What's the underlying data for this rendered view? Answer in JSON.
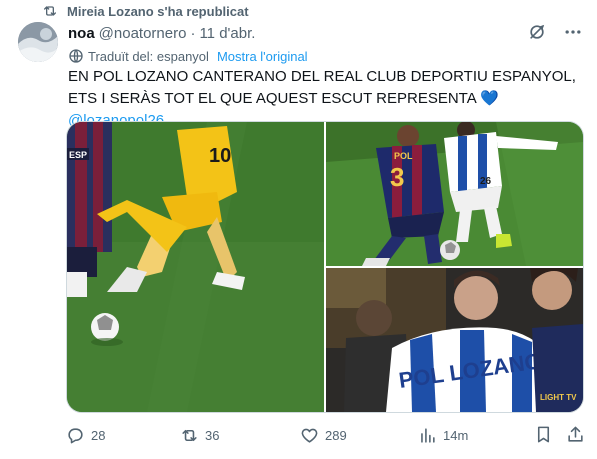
{
  "repost": {
    "text": "Mireia Lozano s'ha republicat",
    "icon": "repost-icon"
  },
  "author": {
    "name": "noa",
    "handle": "@noatornero",
    "separator": "·",
    "date": "11 d'abr."
  },
  "translation": {
    "label": "Traduït del: espanyol",
    "link": "Mostra l'original"
  },
  "tweet": {
    "text": "EN POL LOZANO CANTERANO DEL REAL CLUB DEPORTIU ESPANYOL, ETS I SERÀS TOT EL QUE AQUEST ESCUT REPRESENTA",
    "emoji": "💙",
    "mention": "@lozanopol26"
  },
  "media": {
    "image1": {
      "badge": "ESP",
      "shirt_text": "10"
    },
    "image2": {
      "shirt_name": "POL",
      "shirt_number": "3",
      "shirt_number2": "26"
    },
    "image3": {
      "shirt_name": "POL LOZANO",
      "sponsor": "LIGHT TV"
    }
  },
  "actions": {
    "replies": "28",
    "reposts": "36",
    "likes": "289",
    "views": "14m"
  },
  "colors": {
    "accent": "#1d9bf0",
    "secondary_text": "#536471",
    "pitch": "#3f7a2e",
    "espanyol_blue": "#1e4fa8"
  }
}
